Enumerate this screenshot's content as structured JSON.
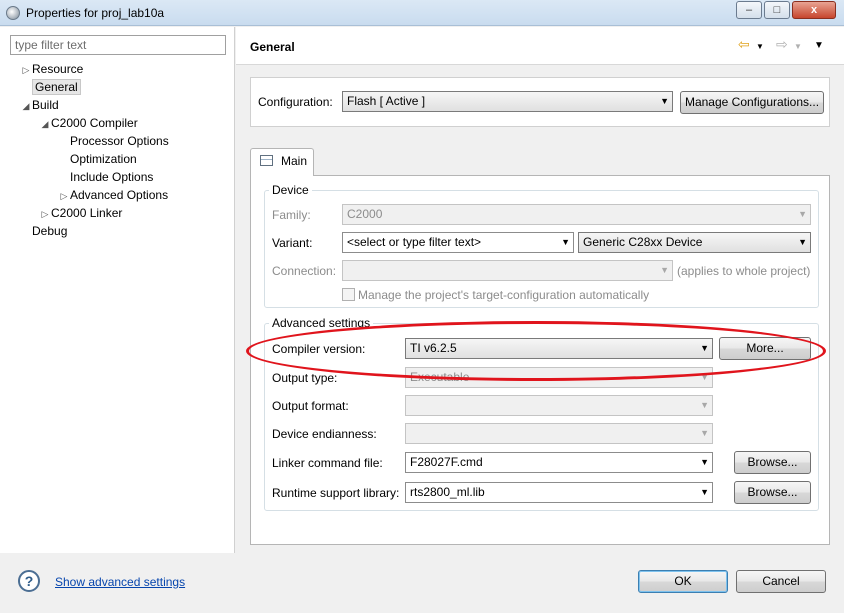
{
  "window": {
    "title": "Properties for proj_lab10a",
    "min_label": "–",
    "max_label": "□",
    "close_label": "x"
  },
  "sidebar": {
    "filter_placeholder": "type filter text",
    "items": [
      {
        "label": "Resource",
        "level": 0,
        "arrow": "▷"
      },
      {
        "label": "General",
        "level": 0,
        "arrow": "",
        "selected": true
      },
      {
        "label": "Build",
        "level": 0,
        "arrow": "◢"
      },
      {
        "label": "C2000 Compiler",
        "level": 1,
        "arrow": "◢"
      },
      {
        "label": "Processor Options",
        "level": 2,
        "arrow": ""
      },
      {
        "label": "Optimization",
        "level": 2,
        "arrow": ""
      },
      {
        "label": "Include Options",
        "level": 2,
        "arrow": ""
      },
      {
        "label": "Advanced Options",
        "level": 2,
        "arrow": "▷"
      },
      {
        "label": "C2000 Linker",
        "level": 1,
        "arrow": "▷"
      },
      {
        "label": "Debug",
        "level": 0,
        "arrow": ""
      }
    ]
  },
  "header": {
    "title": "General",
    "back_icon": "⇦",
    "forward_icon": "⇨",
    "menu_icon": "▼"
  },
  "configuration": {
    "label": "Configuration:",
    "value": "Flash  [ Active ]",
    "manage_label": "Manage Configurations..."
  },
  "tab": {
    "label": "Main"
  },
  "device": {
    "group_title": "Device",
    "family_label": "Family:",
    "family_value": "C2000",
    "variant_label": "Variant:",
    "variant_filter": "<select or type filter text>",
    "variant_value": "Generic C28xx Device",
    "connection_label": "Connection:",
    "connection_value": "",
    "connection_note": "(applies to whole project)",
    "manage_target_label": "Manage the project's target-configuration automatically"
  },
  "advanced": {
    "group_title": "Advanced settings",
    "compiler_version_label": "Compiler version:",
    "compiler_version_value": "TI v6.2.5",
    "more_label": "More...",
    "output_type_label": "Output type:",
    "output_type_value": "Executable",
    "output_format_label": "Output format:",
    "output_format_value": "",
    "endianness_label": "Device endianness:",
    "endianness_value": "",
    "linker_cmd_label": "Linker command file:",
    "linker_cmd_value": "F28027F.cmd",
    "browse_label": "Browse...",
    "rts_label": "Runtime support library:",
    "rts_value": "rts2800_ml.lib",
    "browse2_label": "Browse..."
  },
  "footer": {
    "help_label": "?",
    "show_advanced_label": "Show advanced settings",
    "ok_label": "OK",
    "cancel_label": "Cancel"
  },
  "colors": {
    "highlight_ellipse": "#e0141c",
    "link": "#0645ad"
  }
}
